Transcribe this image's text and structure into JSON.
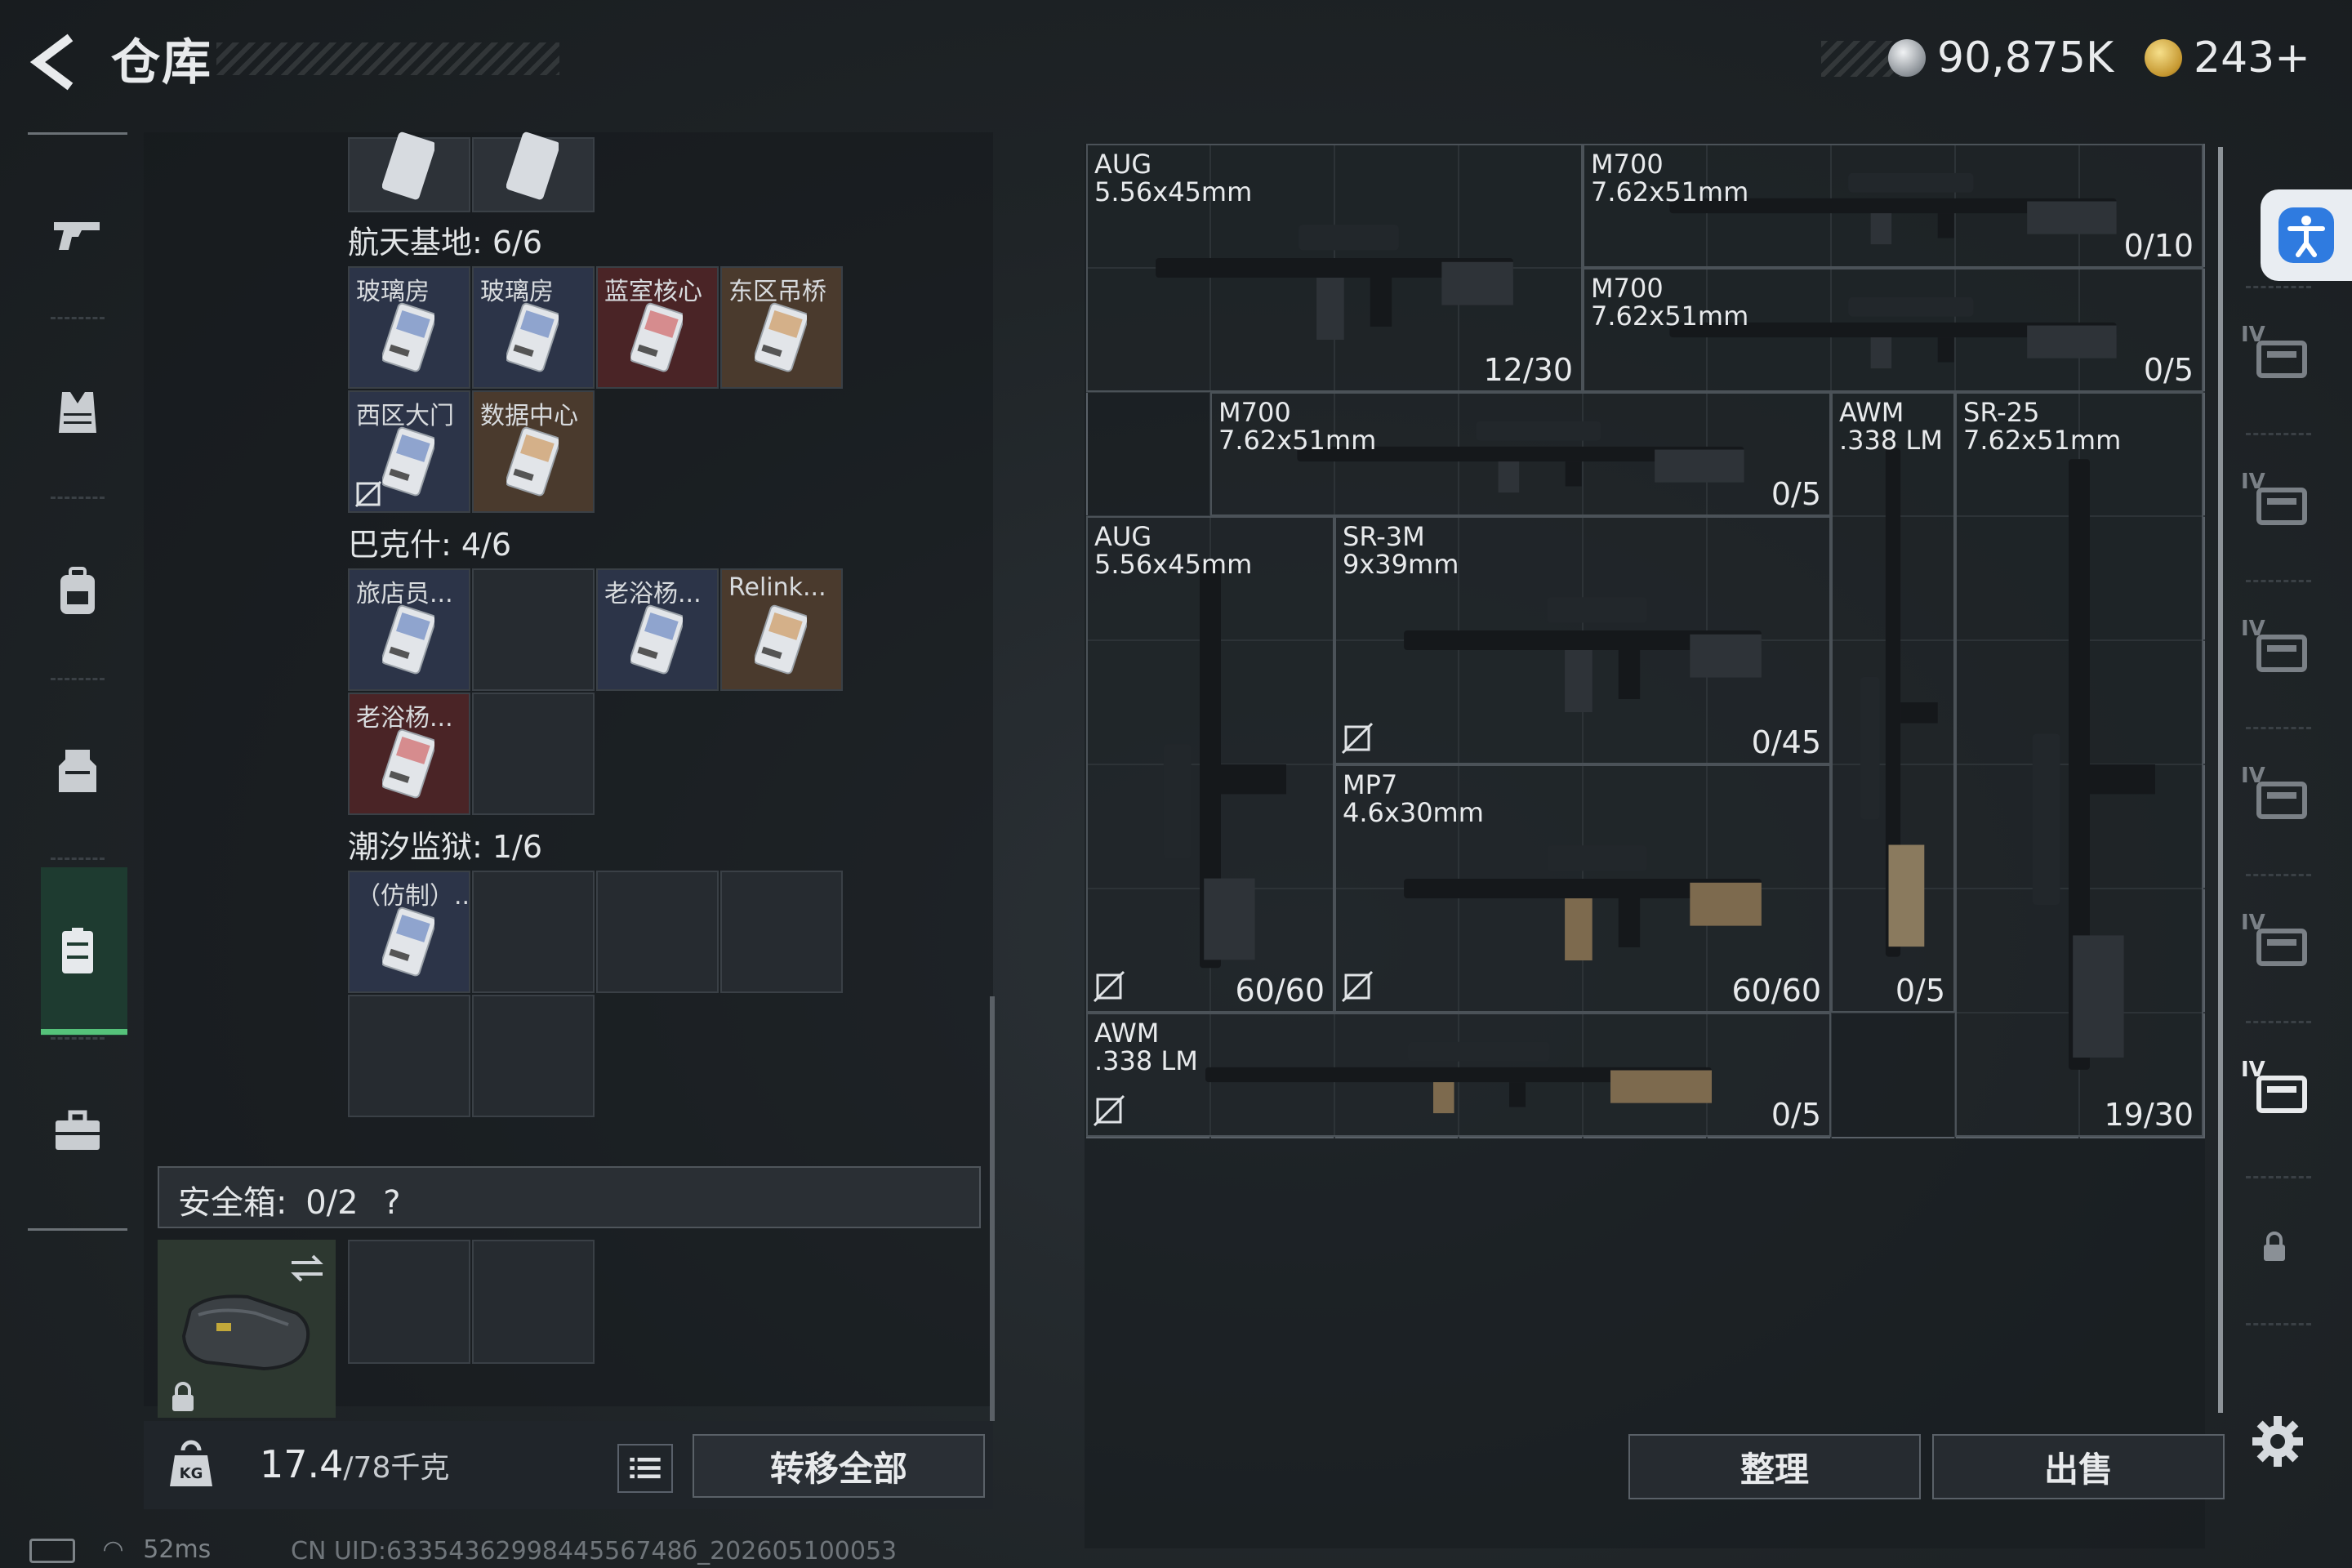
{
  "header": {
    "title": "仓库",
    "currency_silver": "90,875K",
    "currency_gold": "243+"
  },
  "left_panel": {
    "sections": [
      {
        "title": "航天基地: 6/6",
        "cards": [
          {
            "label": "玻璃房",
            "tone": "blue"
          },
          {
            "label": "玻璃房",
            "tone": "blue"
          },
          {
            "label": "蓝室核心",
            "tone": "red"
          },
          {
            "label": "东区吊桥",
            "tone": "brown"
          },
          {
            "label": "西区大门",
            "tone": "blue"
          },
          {
            "label": "数据中心",
            "tone": "brown"
          }
        ]
      },
      {
        "title": "巴克什: 4/6",
        "cards": [
          {
            "label": "旅店员...",
            "tone": "blue"
          },
          {
            "label": "老浴杨...",
            "tone": "blue"
          },
          {
            "label": "Relink...",
            "tone": "brown"
          },
          {
            "label": "老浴杨...",
            "tone": "red"
          }
        ]
      },
      {
        "title": "潮汐监狱: 1/6",
        "cards": [
          {
            "label": "（仿制）...",
            "tone": "blue"
          }
        ]
      }
    ],
    "safe_box": {
      "label": "安全箱:",
      "value": "0/2",
      "help": "?"
    },
    "weight": {
      "value": "17.4",
      "capacity": "/78千克"
    },
    "transfer_all": "转移全部"
  },
  "weapons": [
    {
      "name": "AUG",
      "caliber": "5.56x45mm",
      "count": "12/30"
    },
    {
      "name": "M700",
      "caliber": "7.62x51mm",
      "count": "0/10"
    },
    {
      "name": "M700",
      "caliber": "7.62x51mm",
      "count": "0/5"
    },
    {
      "name": "M700",
      "caliber": "7.62x51mm",
      "count": "0/5"
    },
    {
      "name": "AWM",
      "caliber": ".338 LM",
      "count": "0/5"
    },
    {
      "name": "SR-25",
      "caliber": "7.62x51mm",
      "count": "19/30"
    },
    {
      "name": "AUG",
      "caliber": "5.56x45mm",
      "count": "60/60"
    },
    {
      "name": "SR-3M",
      "caliber": "9x39mm",
      "count": "0/45"
    },
    {
      "name": "MP7",
      "caliber": "4.6x30mm",
      "count": "60/60"
    },
    {
      "name": "AWM",
      "caliber": ".338 LM",
      "count": "0/5"
    }
  ],
  "actions": {
    "sort": "整理",
    "sell": "出售"
  },
  "rail": {
    "tier_label": "IV"
  },
  "status": {
    "ping": "52ms",
    "uid": "CN UID:6335436299844556748б_202605100053"
  },
  "colors": {
    "accent_green": "#55c27a",
    "card_red": "#4a2426",
    "card_brown": "#4a3a2d",
    "card_blue": "#2c3448"
  }
}
